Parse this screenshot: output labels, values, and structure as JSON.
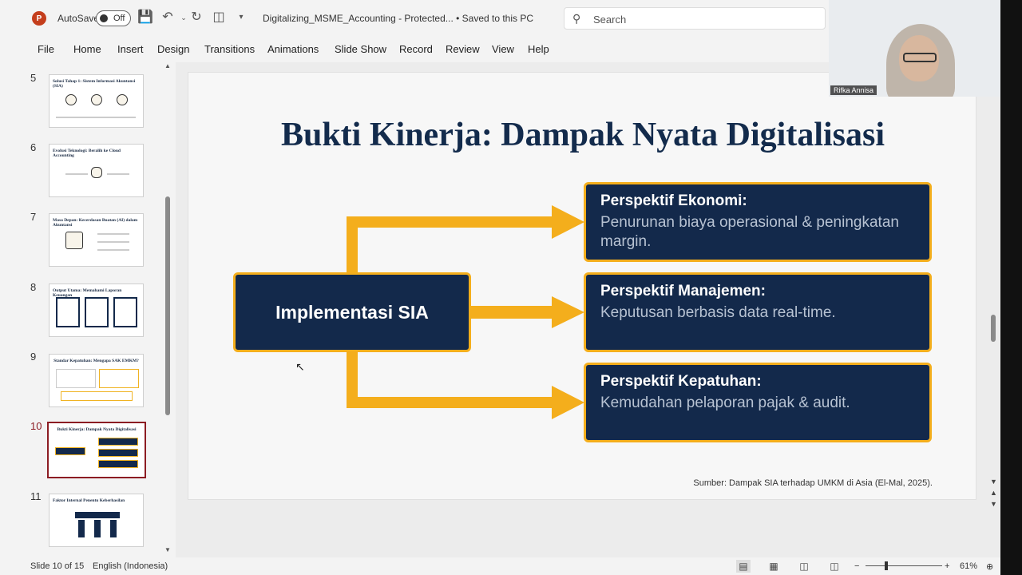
{
  "titlebar": {
    "app_logo": "P",
    "autosave_label": "AutoSave",
    "autosave_state": "Off",
    "doc_title": "Digitalizing_MSME_Accounting  -  Protected...  •  Saved to this PC",
    "search_placeholder": "Search"
  },
  "ribbon": {
    "tabs": [
      "File",
      "Home",
      "Insert",
      "Design",
      "Transitions",
      "Animations",
      "Slide Show",
      "Record",
      "Review",
      "View",
      "Help"
    ]
  },
  "video": {
    "name": "Rifka Annisa"
  },
  "thumbnails": [
    {
      "num": "5",
      "title": "Solusi Tahap 1: Sistem Informasi Akuntansi (SIA)"
    },
    {
      "num": "6",
      "title": "Evolusi Teknologi: Beralih ke Cloud Accounting"
    },
    {
      "num": "7",
      "title": "Masa Depan: Kecerdasan Buatan (AI) dalam Akuntansi"
    },
    {
      "num": "8",
      "title": "Output Utama: Memahami Laporan Keuangan"
    },
    {
      "num": "9",
      "title": "Standar Kepatuhan: Mengapa SAK EMKM?"
    },
    {
      "num": "10",
      "title": "Bukti Kinerja: Dampak Nyata Digitalisasi"
    },
    {
      "num": "11",
      "title": "Faktor Internal Penentu Keberhasilan"
    }
  ],
  "slide": {
    "title": "Bukti Kinerja: Dampak Nyata Digitalisasi",
    "main_box": "Implementasi SIA",
    "perspectives": [
      {
        "title": "Perspektif Ekonomi:",
        "desc": "Penurunan biaya operasional & peningkatan margin."
      },
      {
        "title": "Perspektif Manajemen:",
        "desc": "Keputusan berbasis data real-time."
      },
      {
        "title": "Perspektif Kepatuhan:",
        "desc": "Kemudahan pelaporan pajak & audit."
      }
    ],
    "source": "Sumber: Dampak SIA terhadap UMKM di Asia (El-Mal, 2025)."
  },
  "status": {
    "slide_info": "Slide 10 of 15",
    "language": "English (Indonesia)",
    "zoom": "61%"
  },
  "colors": {
    "navy": "#13294b",
    "gold": "#f4ae1c",
    "active_thumb": "#8c1c23"
  }
}
